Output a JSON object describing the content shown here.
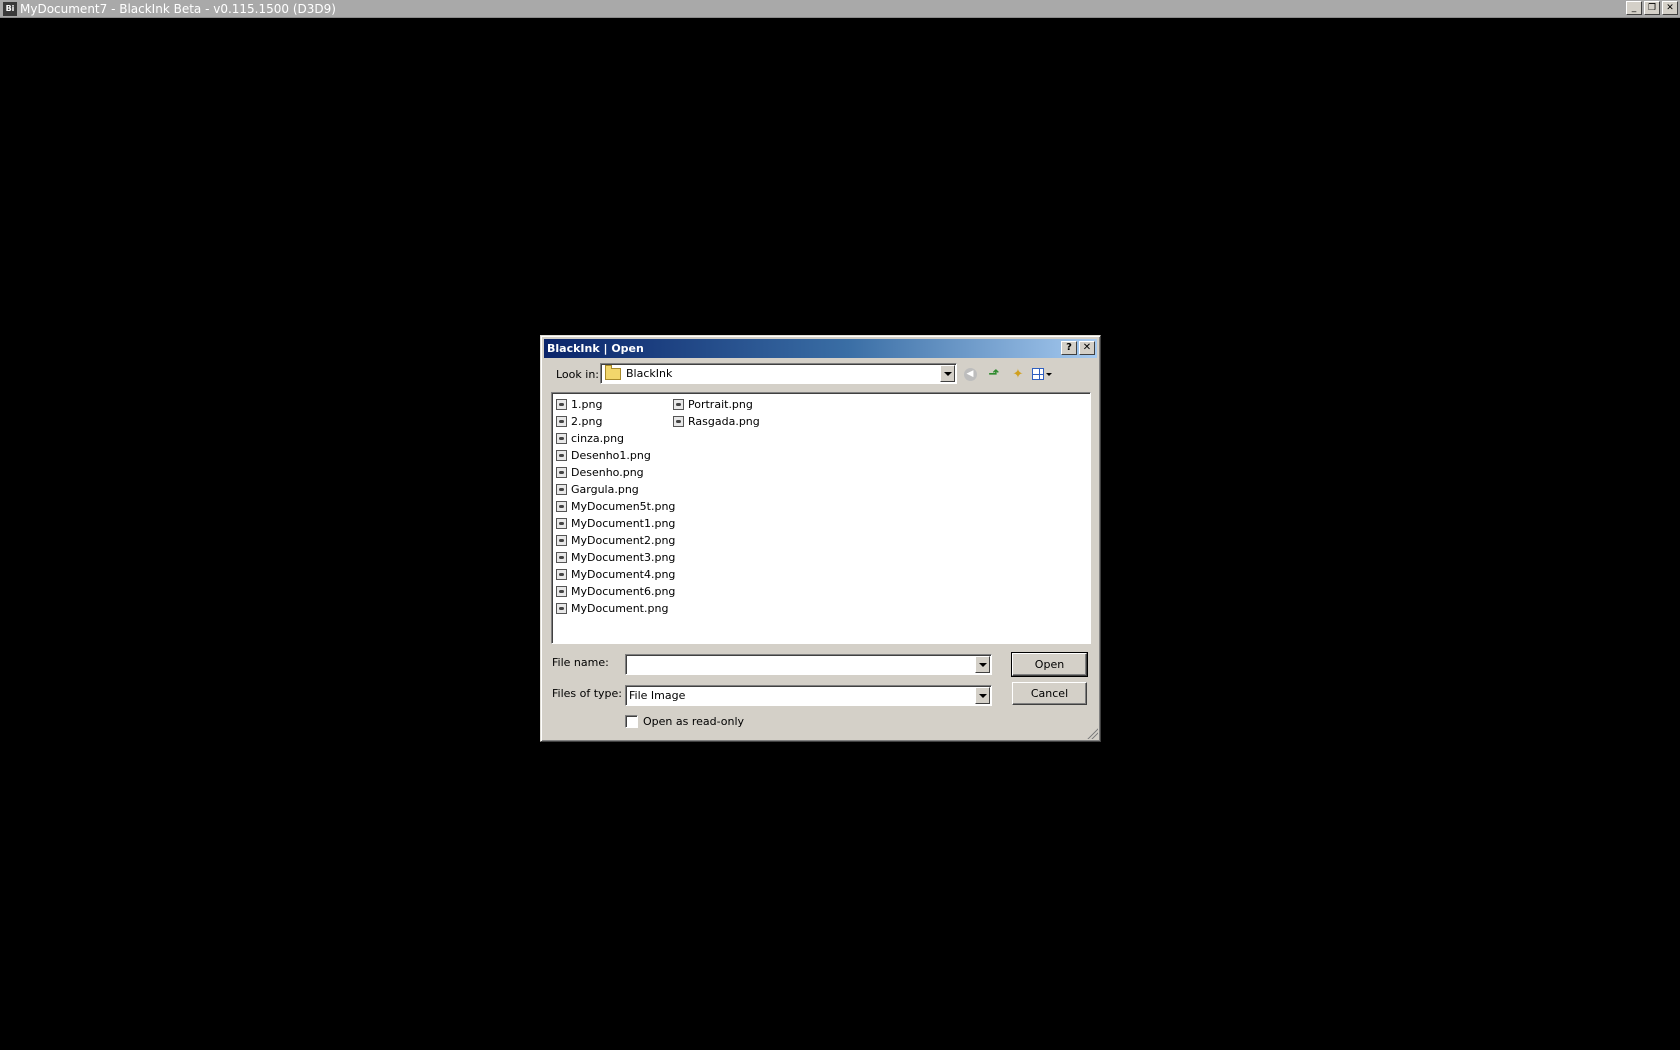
{
  "app": {
    "title": "MyDocument7 - BlackInk Beta - v0.115.1500 (D3D9)",
    "icon_label": "Bi"
  },
  "dialog": {
    "title": "BlackInk | Open",
    "help_label": "?",
    "close_label": "✕",
    "look_in_label": "Look in:",
    "look_in_value": "BlackInk",
    "file_name_label": "File name:",
    "file_name_value": "",
    "files_of_type_label": "Files of type:",
    "files_of_type_value": "File Image",
    "open_label": "Open",
    "cancel_label": "Cancel",
    "read_only_label": "Open as read-only"
  },
  "files": {
    "column1": [
      "1.png",
      "2.png",
      "cinza.png",
      "Desenho1.png",
      "Desenho.png",
      "Gargula.png",
      "MyDocumen5t.png",
      "MyDocument1.png",
      "MyDocument2.png",
      "MyDocument3.png",
      "MyDocument4.png",
      "MyDocument6.png",
      "MyDocument.png"
    ],
    "column2": [
      "Portrait.png",
      "Rasgada.png"
    ]
  },
  "window_controls": {
    "minimize": "_",
    "maximize": "❐",
    "close": "✕"
  },
  "colors": {
    "dialog_title_start": "#0a246a",
    "dialog_title_end": "#a6caf0",
    "app_titlebar": "#a9a9a9"
  }
}
